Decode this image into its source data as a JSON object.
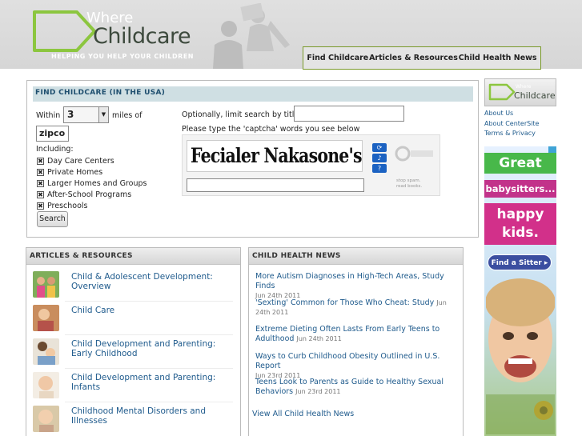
{
  "header": {
    "logo_where": "Where",
    "logo_childcare": "Childcare",
    "tagline": "HELPING YOU HELP YOUR CHILDREN",
    "nav": [
      "Find Childcare",
      "Articles & Resources",
      "Child Health News"
    ]
  },
  "find": {
    "title": "FIND CHILDCARE (IN THE USA)",
    "within_label": "Within",
    "within_value": "3",
    "miles_label": "miles of",
    "zip_value": "zipco",
    "including_label": "Including:",
    "types": [
      "Day Care Centers",
      "Private Homes",
      "Larger Homes and Groups",
      "After-School Programs",
      "Preschools"
    ],
    "search_label": "Search",
    "optional_label": "Optionally, limit search by title:",
    "captcha_label": "Please type the 'captcha' words you see below",
    "captcha_words": "Fecialer Nakasone's",
    "recaptcha_tagline_1": "stop spam.",
    "recaptcha_tagline_2": "read books."
  },
  "articles": {
    "title": "ARTICLES & RESOURCES",
    "items": [
      "Child & Adolescent Development: Overview",
      "Child Care",
      "Child Development and Parenting: Early Childhood",
      "Child Development and Parenting: Infants",
      "Childhood Mental Disorders and Illnesses"
    ]
  },
  "health": {
    "title": "CHILD HEALTH NEWS",
    "items": [
      {
        "title": "More Autism Diagnoses in High-Tech Areas, Study Finds",
        "date": "Jun 24th 2011"
      },
      {
        "title": "'Sexting' Common for Those Who Cheat: Study",
        "date": "Jun 24th 2011"
      },
      {
        "title": "Extreme Dieting Often Lasts From Early Teens to Adulthood",
        "date": "Jun 24th 2011"
      },
      {
        "title": "Ways to Curb Childhood Obesity Outlined in U.S. Report",
        "date": "Jun 23rd 2011"
      },
      {
        "title": "Teens Look to Parents as Guide to Healthy Sexual Behaviors",
        "date": "Jun 23rd 2011"
      }
    ],
    "view_all": "View All Child Health News"
  },
  "side": {
    "logo_text": "Childcare",
    "logo_where": "Where",
    "links": [
      "About Us",
      "About CenterSite",
      "Terms & Privacy"
    ]
  },
  "ad": {
    "line1": "Great",
    "line2": "babysitters...",
    "line3": "happy kids.",
    "button": "Find a Sitter ▸"
  },
  "colors": {
    "brand_green": "#8bc34a",
    "link_blue": "#1e5a8c",
    "panel_bar": "#cfdfe3"
  }
}
